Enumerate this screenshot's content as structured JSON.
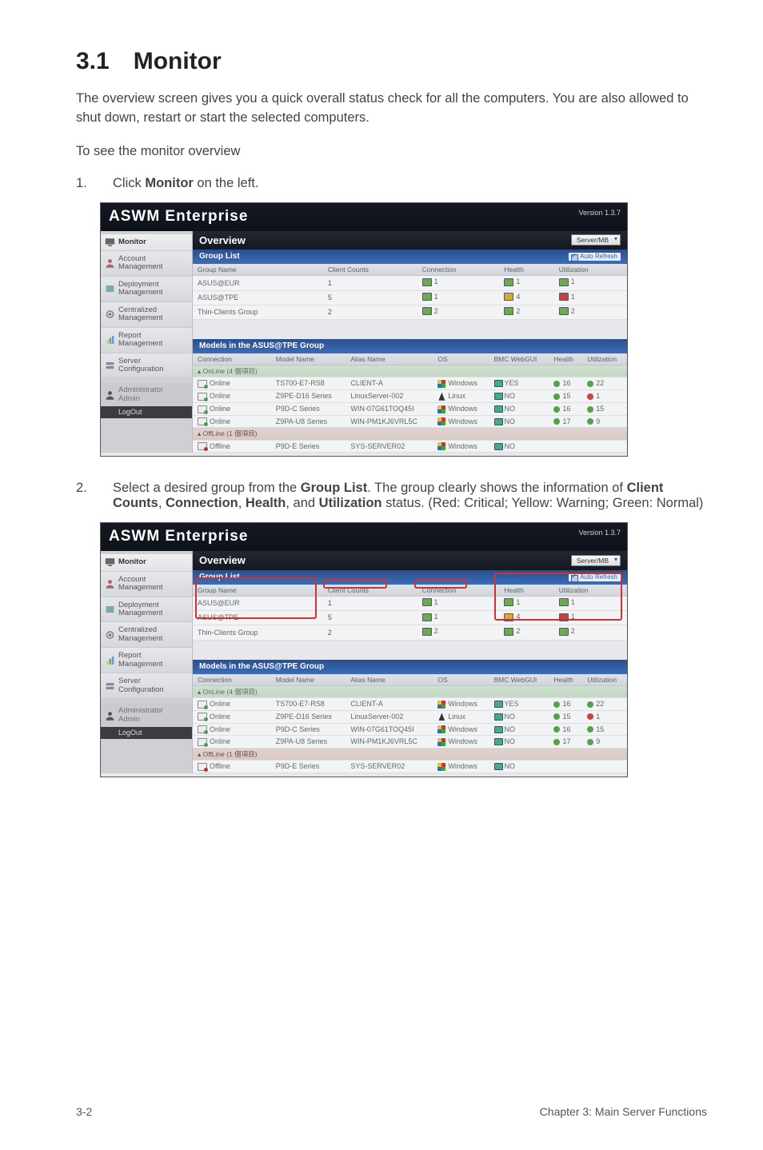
{
  "heading": "3.1 Monitor",
  "intro_p1": "The overview screen gives you a quick overall status check for all the computers. You are also allowed to shut down, restart or start the selected computers.",
  "intro_p2": "To see the monitor overview",
  "step1": {
    "num": "1.",
    "pre": "Click ",
    "bold": "Monitor",
    "post": " on the left."
  },
  "step2": {
    "num": "2.",
    "parts": [
      {
        "t": "Select a desired group from the "
      },
      {
        "b": "Group List"
      },
      {
        "t": ". The group clearly shows the information of "
      },
      {
        "b": "Client Counts"
      },
      {
        "t": ", "
      },
      {
        "b": "Connection"
      },
      {
        "t": ", "
      },
      {
        "b": "Health"
      },
      {
        "t": ", and "
      },
      {
        "b": "Utilization"
      },
      {
        "t": " status. (Red: Critical; Yellow: Warning; Green: Normal)"
      }
    ]
  },
  "footer": {
    "left": "3-2",
    "right": "Chapter 3: Main Server Functions"
  },
  "app": {
    "brand": "ASWM Enterprise",
    "version": "Version 1.3.7",
    "view_selector": "Server/MB",
    "overview_title": "Overview",
    "auto_refresh": "Auto Refresh",
    "nav": [
      "Monitor",
      "Account\nManagement",
      "Deployment\nManagement",
      "Centralized\nManagement",
      "Report\nManagement",
      "Server\nConfiguration"
    ],
    "admin_label": "Administrator\nAdmin",
    "logout": "LogOut",
    "group_list": {
      "title": "Group List",
      "headers": [
        "Group Name",
        "Client Counts",
        "Connection",
        "Health",
        "Utilization"
      ],
      "rows": [
        {
          "name": "ASUS@EUR",
          "counts": "1",
          "conn": "1",
          "conn_color": "green",
          "health": "1",
          "health_color": "green",
          "util": "1",
          "util_color": "green"
        },
        {
          "name": "ASUS@TPE",
          "counts": "5",
          "conn": "1",
          "conn_color": "green",
          "health": "4",
          "health_color": "yellow",
          "util": "1",
          "util_color": "red"
        },
        {
          "name": "Thin-Clients Group",
          "counts": "2",
          "conn": "2",
          "conn_color": "green",
          "health": "2",
          "health_color": "green",
          "util": "2",
          "util_color": "green"
        }
      ]
    },
    "models": {
      "title": "Models in the ASUS@TPE Group",
      "headers": [
        "Connection",
        "Model Name",
        "Alias Name",
        "OS",
        "BMC WebGUI",
        "Health",
        "Utilization"
      ],
      "section_on": "OnLine (4 個項目)",
      "section_off": "OffLine (1 個項目)",
      "rows_on": [
        {
          "conn": "Online",
          "model": "TS700-E7-RS8",
          "alias": "CLIENT-A",
          "os": "Windows",
          "os_icon": "win",
          "bmc": "YES",
          "health": "16",
          "h": "g",
          "util": "22",
          "u": "g"
        },
        {
          "conn": "Online",
          "model": "Z9PE-D16 Series",
          "alias": "LinuxServer-002",
          "os": "Linux",
          "os_icon": "lin",
          "bmc": "NO",
          "health": "15",
          "h": "g",
          "util": "1",
          "u": "r"
        },
        {
          "conn": "Online",
          "model": "P9D-C Series",
          "alias": "WIN-07G61TOQ45I",
          "os": "Windows",
          "os_icon": "win",
          "bmc": "NO",
          "health": "16",
          "h": "g",
          "util": "15",
          "u": "g"
        },
        {
          "conn": "Online",
          "model": "Z9PA-U8 Series",
          "alias": "WIN-PM1KJ6VRL5C",
          "os": "Windows",
          "os_icon": "win",
          "bmc": "NO",
          "health": "17",
          "h": "g",
          "util": "9",
          "u": "g"
        }
      ],
      "rows_off": [
        {
          "conn": "Offline",
          "model": "P9D-E Series",
          "alias": "SYS-SERVER02",
          "os": "Windows",
          "os_icon": "win",
          "bmc": "NO",
          "health": "",
          "h": "",
          "util": "",
          "u": ""
        }
      ]
    }
  }
}
